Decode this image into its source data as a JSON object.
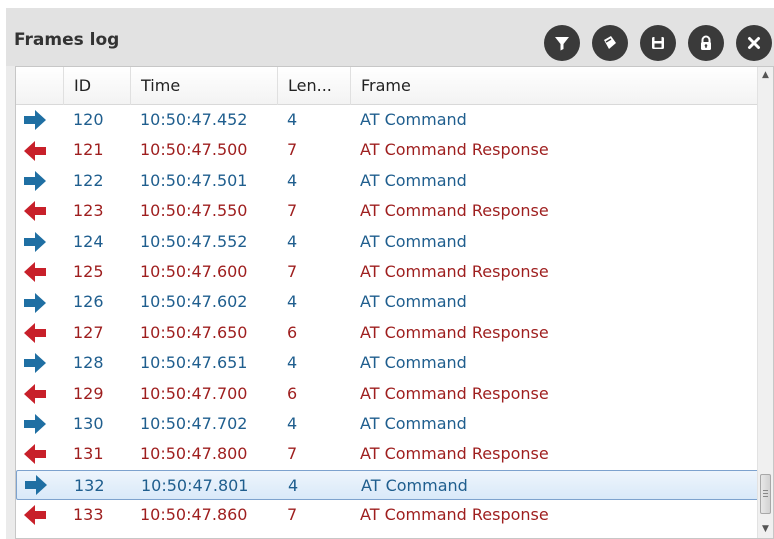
{
  "panel": {
    "title": "Frames log"
  },
  "toolbar": {
    "icons": [
      "filter-icon",
      "clear-icon",
      "save-icon",
      "lock-icon",
      "close-icon"
    ]
  },
  "table": {
    "columns": [
      "ID",
      "Time",
      "Len...",
      "Frame"
    ],
    "rows": [
      {
        "dir": "out",
        "id": "120",
        "time": "10:50:47.452",
        "len": "4",
        "frame": "AT Command"
      },
      {
        "dir": "in",
        "id": "121",
        "time": "10:50:47.500",
        "len": "7",
        "frame": "AT Command Response"
      },
      {
        "dir": "out",
        "id": "122",
        "time": "10:50:47.501",
        "len": "4",
        "frame": "AT Command"
      },
      {
        "dir": "in",
        "id": "123",
        "time": "10:50:47.550",
        "len": "7",
        "frame": "AT Command Response"
      },
      {
        "dir": "out",
        "id": "124",
        "time": "10:50:47.552",
        "len": "4",
        "frame": "AT Command"
      },
      {
        "dir": "in",
        "id": "125",
        "time": "10:50:47.600",
        "len": "7",
        "frame": "AT Command Response"
      },
      {
        "dir": "out",
        "id": "126",
        "time": "10:50:47.602",
        "len": "4",
        "frame": "AT Command"
      },
      {
        "dir": "in",
        "id": "127",
        "time": "10:50:47.650",
        "len": "6",
        "frame": "AT Command Response"
      },
      {
        "dir": "out",
        "id": "128",
        "time": "10:50:47.651",
        "len": "4",
        "frame": "AT Command"
      },
      {
        "dir": "in",
        "id": "129",
        "time": "10:50:47.700",
        "len": "6",
        "frame": "AT Command Response"
      },
      {
        "dir": "out",
        "id": "130",
        "time": "10:50:47.702",
        "len": "4",
        "frame": "AT Command"
      },
      {
        "dir": "in",
        "id": "131",
        "time": "10:50:47.800",
        "len": "7",
        "frame": "AT Command Response"
      },
      {
        "dir": "out",
        "id": "132",
        "time": "10:50:47.801",
        "len": "4",
        "frame": "AT Command",
        "selected": true
      },
      {
        "dir": "in",
        "id": "133",
        "time": "10:50:47.860",
        "len": "7",
        "frame": "AT Command Response"
      }
    ]
  },
  "colors": {
    "outgoing": "#1f6fa3",
    "incoming": "#c8202a",
    "selection_border": "#7da2ce"
  }
}
